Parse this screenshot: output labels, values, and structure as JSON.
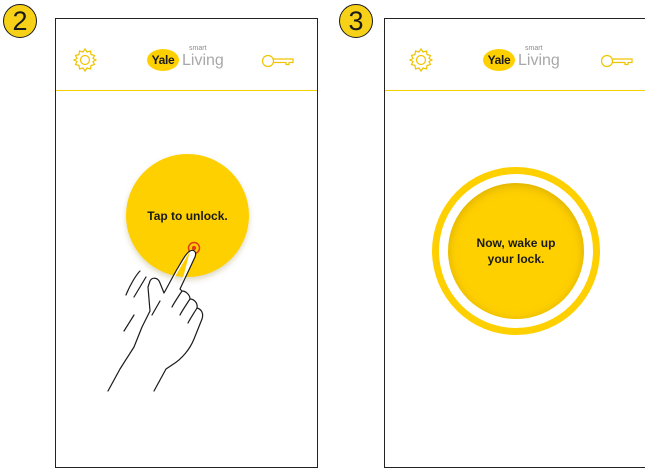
{
  "steps": [
    {
      "number": "2"
    },
    {
      "number": "3"
    }
  ],
  "header": {
    "brand": "Yale",
    "brand_small": "smart",
    "brand_large": "Living",
    "settings_icon": "gear-icon",
    "keys_icon": "key-icon"
  },
  "screen2": {
    "button_label": "Tap to unlock."
  },
  "screen3": {
    "button_label_line1": "Now, wake up",
    "button_label_line2": "your lock."
  },
  "colors": {
    "yellow": "#ffd000",
    "accent_ring": "#e8b800",
    "touch_dot": "#e03a1a"
  }
}
